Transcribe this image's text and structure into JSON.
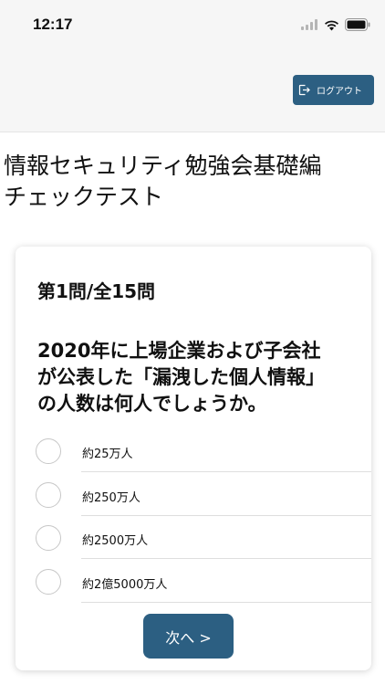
{
  "status_bar": {
    "time": "12:17"
  },
  "header": {
    "logout_label": "ログアウト"
  },
  "page": {
    "title_line1": "情報セキュリティ勉強会基礎編",
    "title_line2": "チェックテスト"
  },
  "quiz": {
    "counter": "第1問/全15問",
    "question_line1": "2020年に上場企業および子会社",
    "question_line2": "が公表した「漏洩した個人情報」",
    "question_line3": "の人数は何人でしょうか。",
    "options": [
      {
        "label": "約25万人"
      },
      {
        "label": "約250万人"
      },
      {
        "label": "約2500万人"
      },
      {
        "label": "約2億5000万人"
      }
    ],
    "next_label": "次へ >"
  },
  "colors": {
    "accent": "#2c5f82",
    "background": "#f6f6f6"
  }
}
